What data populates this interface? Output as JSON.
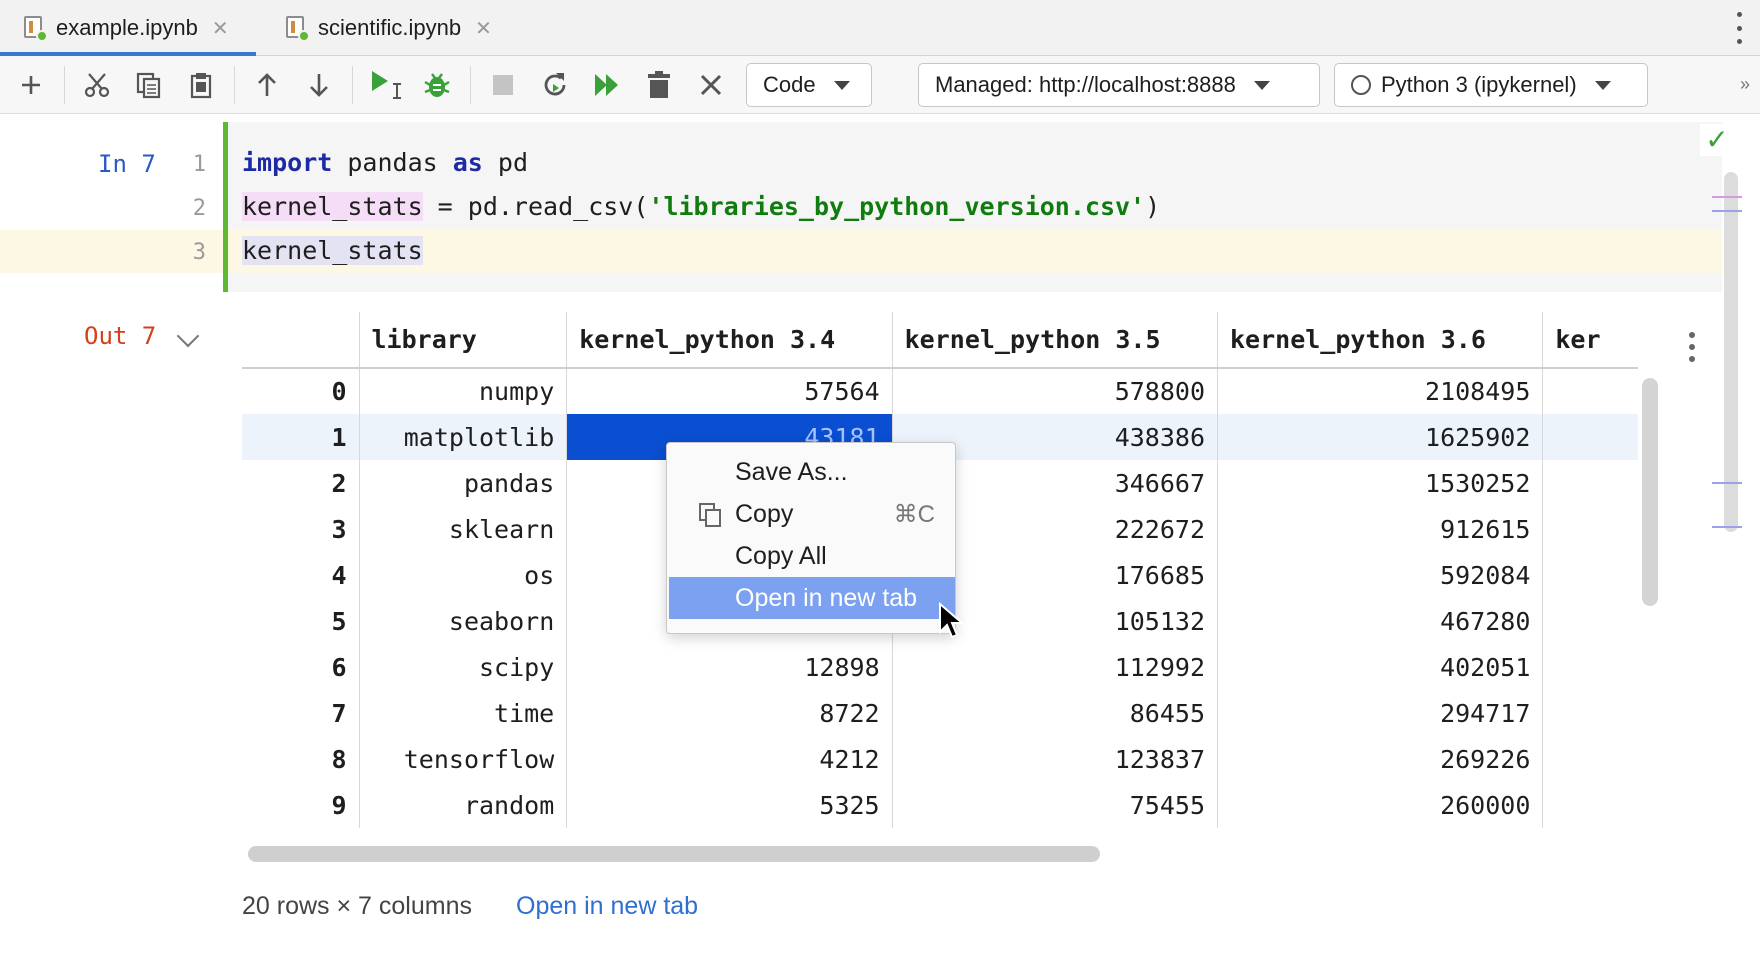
{
  "tabs": [
    {
      "label": "example.ipynb",
      "active": true
    },
    {
      "label": "scientific.ipynb",
      "active": false
    }
  ],
  "toolbar": {
    "cell_type": "Code",
    "server": "Managed: http://localhost:8888",
    "kernel": "Python 3 (ipykernel)",
    "icons": [
      "add-cell-icon",
      "cut-icon",
      "copy-icon",
      "paste-icon",
      "move-up-icon",
      "move-down-icon",
      "run-icon",
      "debug-icon",
      "stop-icon",
      "restart-icon",
      "run-all-icon",
      "delete-icon",
      "clear-icon"
    ]
  },
  "cell": {
    "in_label": "In 7",
    "line_numbers": [
      "1",
      "2",
      "3"
    ],
    "code": {
      "l1_kw1": "import",
      "l1_mid": " pandas ",
      "l1_kw2": "as",
      "l1_end": " pd",
      "l2_var": "kernel_stats",
      "l2_mid": " = pd.read_csv(",
      "l2_str": "'libraries_by_python_version.csv'",
      "l2_end": ")",
      "l3_var": "kernel_stats"
    }
  },
  "output": {
    "out_label": "Out 7",
    "columns": [
      "",
      "library",
      "kernel_python 3.4",
      "kernel_python 3.5",
      "kernel_python 3.6",
      "ker"
    ],
    "rows": [
      [
        "0",
        "numpy",
        "57564",
        "578800",
        "2108495"
      ],
      [
        "1",
        "matplotlib",
        "43181",
        "438386",
        "1625902"
      ],
      [
        "2",
        "pandas",
        "",
        "346667",
        "1530252"
      ],
      [
        "3",
        "sklearn",
        "",
        "222672",
        "912615"
      ],
      [
        "4",
        "os",
        "",
        "176685",
        "592084"
      ],
      [
        "5",
        "seaborn",
        "",
        "105132",
        "467280"
      ],
      [
        "6",
        "scipy",
        "12898",
        "112992",
        "402051"
      ],
      [
        "7",
        "time",
        "8722",
        "86455",
        "294717"
      ],
      [
        "8",
        "tensorflow",
        "4212",
        "123837",
        "269226"
      ],
      [
        "9",
        "random",
        "5325",
        "75455",
        "260000"
      ]
    ],
    "summary": "20 rows × 7 columns",
    "open_link": "Open in new tab"
  },
  "context_menu": {
    "items": [
      {
        "label": "Save As...",
        "shortcut": ""
      },
      {
        "label": "Copy",
        "shortcut": "⌘C"
      },
      {
        "label": "Copy All",
        "shortcut": ""
      },
      {
        "label": "Open in new tab",
        "shortcut": ""
      }
    ]
  },
  "colors": {
    "accent": "#3b78d4",
    "selection": "#0a4fd1",
    "menu_highlight": "#7ca1f0",
    "cell_bar": "#5fb832"
  }
}
